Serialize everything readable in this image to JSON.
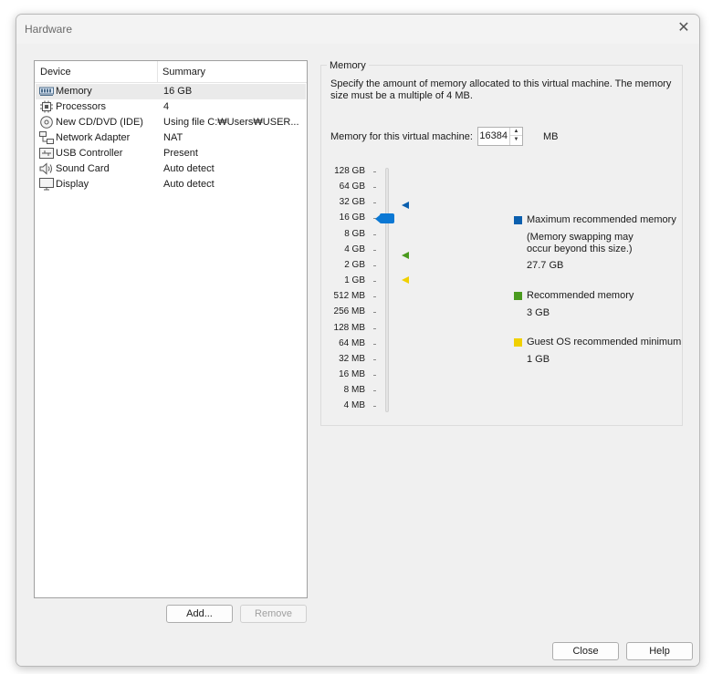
{
  "window": {
    "title": "Hardware"
  },
  "device_list": {
    "col_device": "Device",
    "col_summary": "Summary",
    "rows": [
      {
        "device": "Memory",
        "summary": "16 GB",
        "icon": "memory-icon",
        "selected": true
      },
      {
        "device": "Processors",
        "summary": "4",
        "icon": "processor-icon"
      },
      {
        "device": "New CD/DVD (IDE)",
        "summary": "Using file C:₩Users₩USER...",
        "icon": "cd-dvd-icon"
      },
      {
        "device": "Network Adapter",
        "summary": "NAT",
        "icon": "network-adapter-icon"
      },
      {
        "device": "USB Controller",
        "summary": "Present",
        "icon": "usb-icon"
      },
      {
        "device": "Sound Card",
        "summary": "Auto detect",
        "icon": "speaker-icon"
      },
      {
        "device": "Display",
        "summary": "Auto detect",
        "icon": "monitor-icon"
      }
    ],
    "add_label": "Add...",
    "remove_label": "Remove"
  },
  "memory": {
    "group_title": "Memory",
    "description": "Specify the amount of memory allocated to this virtual machine. The memory size must be a multiple of 4 MB.",
    "field_label": "Memory for this virtual machine:",
    "value": "16384",
    "unit": "MB",
    "scale": [
      "128 GB",
      "64 GB",
      "32 GB",
      "16 GB",
      "8 GB",
      "4 GB",
      "2 GB",
      "1 GB",
      "512 MB",
      "256 MB",
      "128 MB",
      "64 MB",
      "32 MB",
      "16 MB",
      "8 MB",
      "4 MB"
    ],
    "slider_value": "16 GB",
    "legend": {
      "max": {
        "label": "Maximum recommended memory",
        "note": "(Memory swapping may occur beyond this size.)",
        "value": "27.7 GB",
        "color": "#0b5fae"
      },
      "rec": {
        "label": "Recommended memory",
        "value": "3 GB",
        "color": "#4a9a1e"
      },
      "min": {
        "label": "Guest OS recommended minimum",
        "value": "1 GB",
        "color": "#f0d000"
      }
    }
  },
  "footer": {
    "close_label": "Close",
    "help_label": "Help"
  }
}
